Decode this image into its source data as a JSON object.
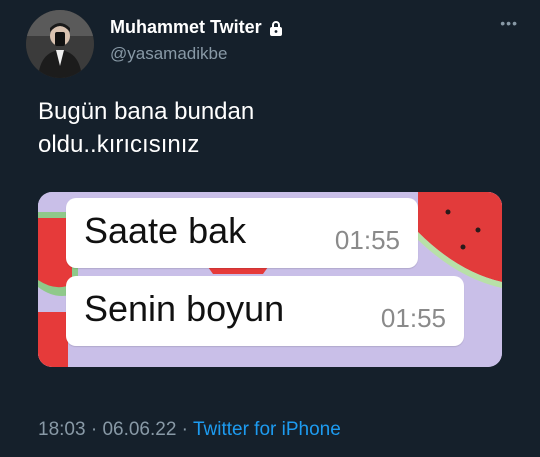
{
  "author": {
    "name": "Muhammet Twiter",
    "handle": "@yasamadikbe",
    "avatar_icon": "person-mirror-selfie",
    "lock_icon": "lock-icon"
  },
  "more_label": "•••",
  "tweet": {
    "line1": "Bugün bana bundan",
    "line2": "oldu..kırıcısınız"
  },
  "media": {
    "background_color": "#c9bfe8",
    "messages": [
      {
        "text": "Saate bak",
        "time": "01:55"
      },
      {
        "text": "Senin boyun",
        "time": "01:55"
      }
    ]
  },
  "meta": {
    "time": "18:03",
    "date": "06.06.22",
    "separator": " · ",
    "source": "Twitter for iPhone"
  },
  "colors": {
    "background": "#15202b",
    "secondary_text": "#8899a6",
    "link": "#1d9bf0"
  }
}
